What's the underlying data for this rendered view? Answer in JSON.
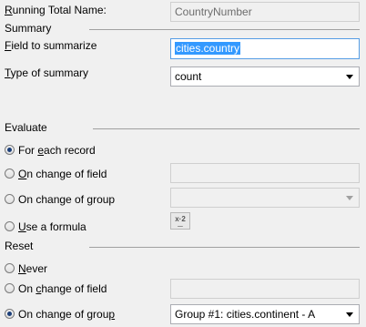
{
  "running_total": {
    "name_label": "Running Total Name:",
    "name_value": "CountryNumber"
  },
  "summary": {
    "section_label": "Summary",
    "field_label": "Field to summarize",
    "field_value": "cities.country",
    "type_label": "Type of summary",
    "type_value": "count"
  },
  "evaluate": {
    "section_label": "Evaluate",
    "options": [
      {
        "label": "For each record",
        "checked": true
      },
      {
        "label": "On change of field",
        "checked": false
      },
      {
        "label": "On change of group",
        "checked": false
      },
      {
        "label": "Use a formula",
        "checked": false
      }
    ],
    "field_value": "",
    "group_value": "",
    "formula_icon": "formula-icon"
  },
  "reset": {
    "section_label": "Reset",
    "options": [
      {
        "label": "Never",
        "checked": false
      },
      {
        "label": "On change of field",
        "checked": false
      },
      {
        "label": "On change of group",
        "checked": true
      }
    ],
    "field_value": "",
    "group_value": "Group #1: cities.continent - A"
  }
}
